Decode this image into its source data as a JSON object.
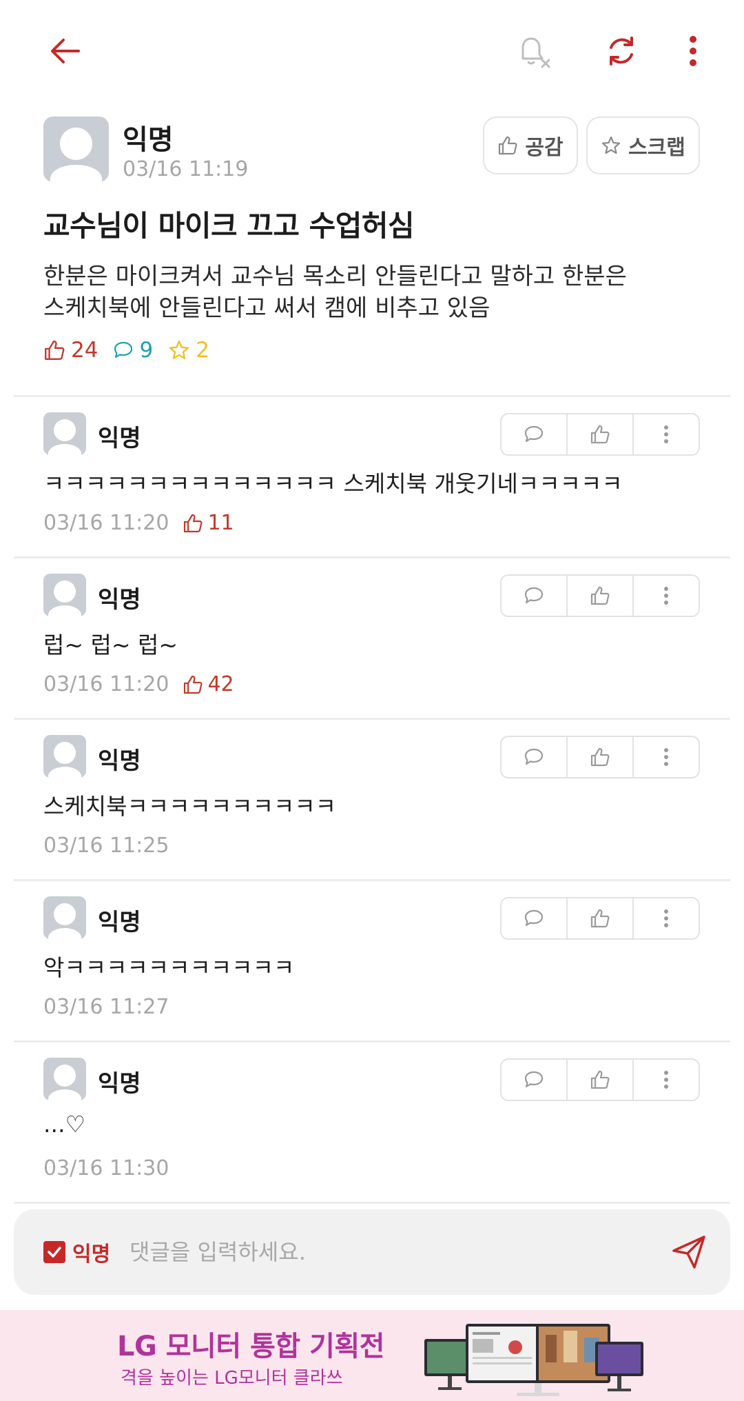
{
  "topbar": {
    "back_icon": "arrow-left-icon",
    "notification_icon": "bell-off-icon",
    "refresh_icon": "refresh-icon",
    "more_icon": "more-vertical-icon"
  },
  "post": {
    "author": "익명",
    "timestamp": "03/16 11:19",
    "like_button_label": "공감",
    "scrap_button_label": "스크랩",
    "title": "교수님이 마이크 끄고 수업허심",
    "body_line1": "한분은 마이크켜서 교수님 목소리 안들린다고 말하고 한분은",
    "body_line2": "스케치북에 안들린다고 써서 캠에 비추고 있음",
    "likes": "24",
    "comments": "9",
    "scraps": "2"
  },
  "comments": [
    {
      "author": "익명",
      "text": "ㅋㅋㅋㅋㅋㅋㅋㅋㅋㅋㅋㅋㅋㅋ 스케치북 개웃기네ㅋㅋㅋㅋㅋ",
      "timestamp": "03/16 11:20",
      "likes": "11"
    },
    {
      "author": "익명",
      "text": "럽~ 럽~ 럽~",
      "timestamp": "03/16 11:20",
      "likes": "42"
    },
    {
      "author": "익명",
      "text": "스케치북ㅋㅋㅋㅋㅋㅋㅋㅋㅋㅋ",
      "timestamp": "03/16 11:25",
      "likes": null
    },
    {
      "author": "익명",
      "text": "악ㅋㅋㅋㅋㅋㅋㅋㅋㅋㅋㅋ",
      "timestamp": "03/16 11:27",
      "likes": null
    },
    {
      "author": "익명",
      "text": "...♡",
      "timestamp": "03/16 11:30",
      "likes": null
    }
  ],
  "input": {
    "anonymous_label": "익명",
    "anonymous_checked": true,
    "placeholder": "댓글을 입력하세요."
  },
  "ad": {
    "title": "LG 모니터 통합 기획전",
    "subtitle": "격을 높이는 LG모니터 클라쓰"
  },
  "colors": {
    "accent": "#c62828",
    "like": "#c0392b",
    "comment": "#1aa3b0",
    "scrap": "#f0c020",
    "ad_background": "#fbe6ee",
    "ad_text": "#b0339a"
  }
}
